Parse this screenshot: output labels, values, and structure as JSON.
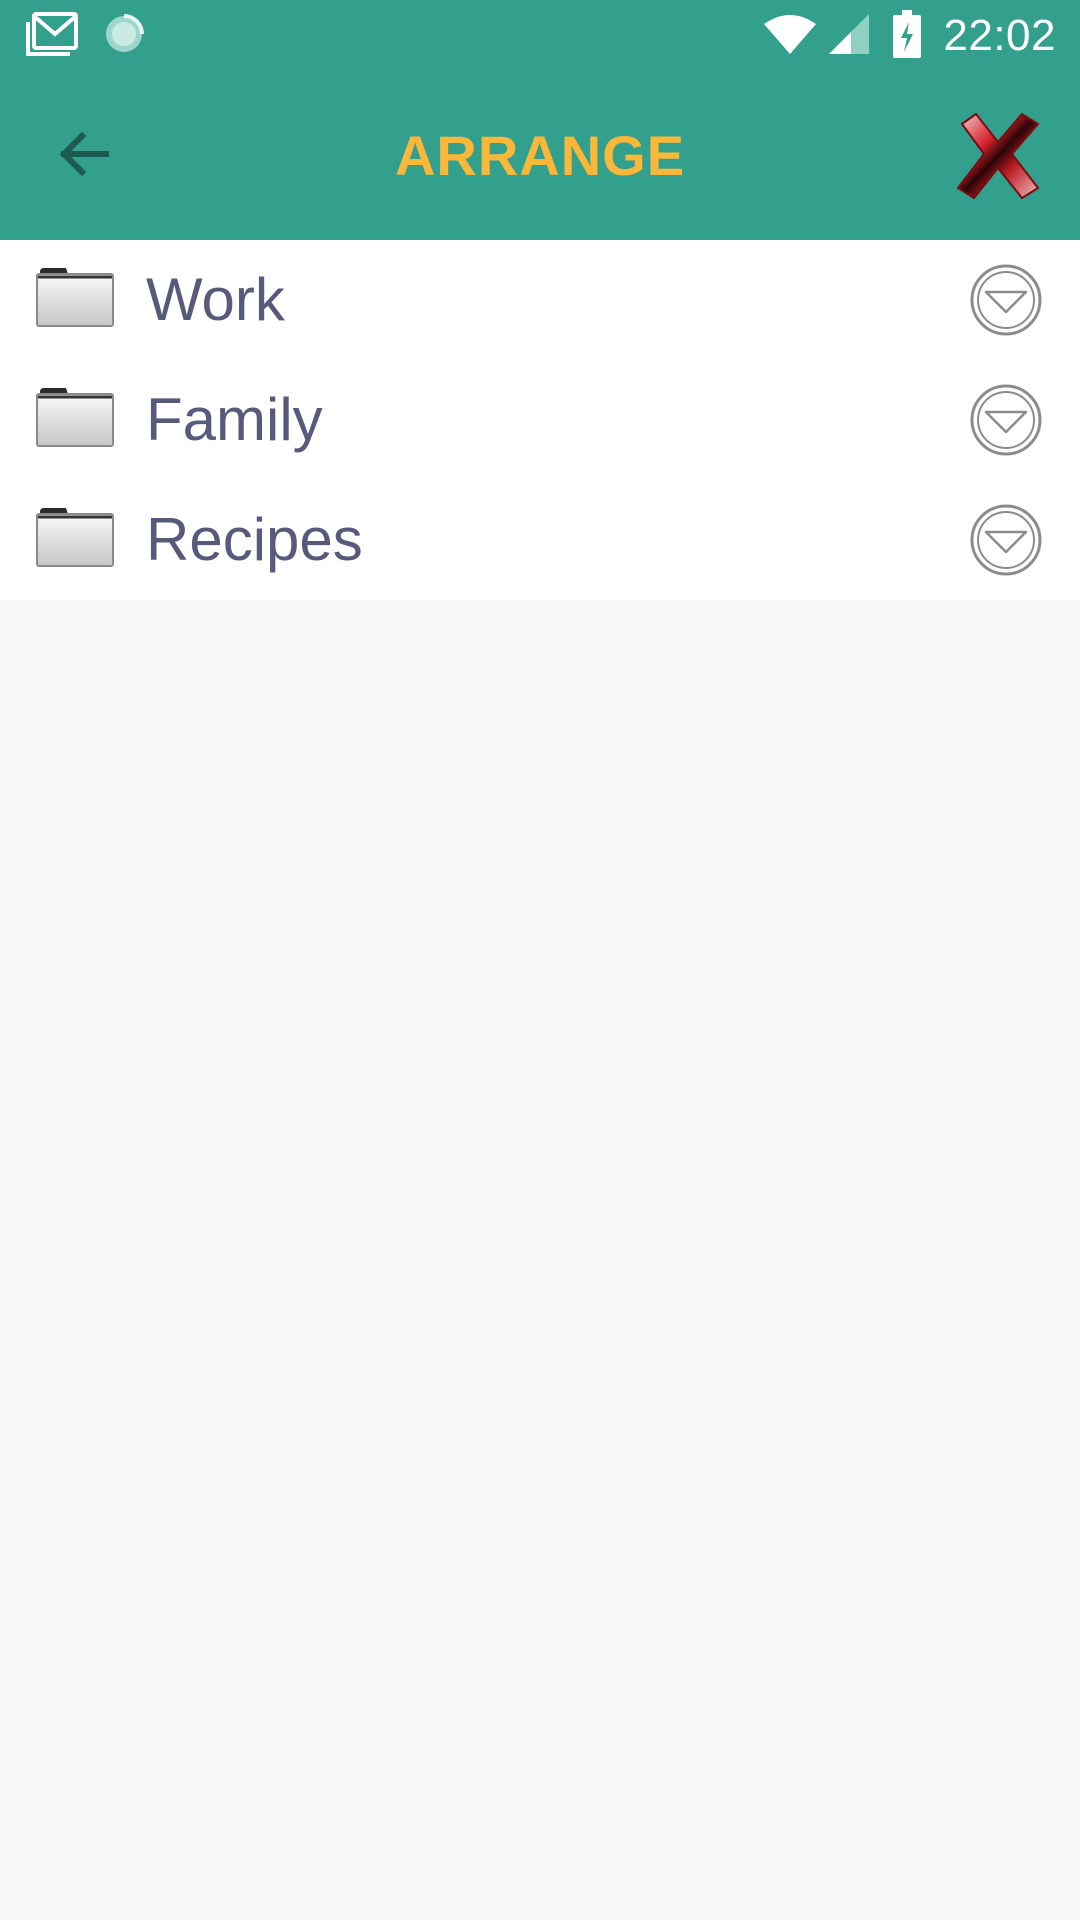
{
  "status_bar": {
    "time": "22:02",
    "icons": [
      "gmail-icon",
      "sync-spinner-icon",
      "wifi-icon",
      "cell-signal-icon",
      "battery-charging-icon"
    ]
  },
  "toolbar": {
    "title": "ARRANGE",
    "back_icon": "arrow-left-icon",
    "close_icon": "red-x-icon"
  },
  "folders": [
    {
      "label": "Work",
      "icon": "folder-icon",
      "action_icon": "move-down-icon"
    },
    {
      "label": "Family",
      "icon": "folder-icon",
      "action_icon": "move-down-icon"
    },
    {
      "label": "Recipes",
      "icon": "folder-icon",
      "action_icon": "move-down-icon"
    }
  ],
  "colors": {
    "header_bg": "#32a08c",
    "title": "#fbb73a",
    "label_text": "#575a7a",
    "list_bg": "#ffffff",
    "page_bg": "#f9f9f9"
  }
}
